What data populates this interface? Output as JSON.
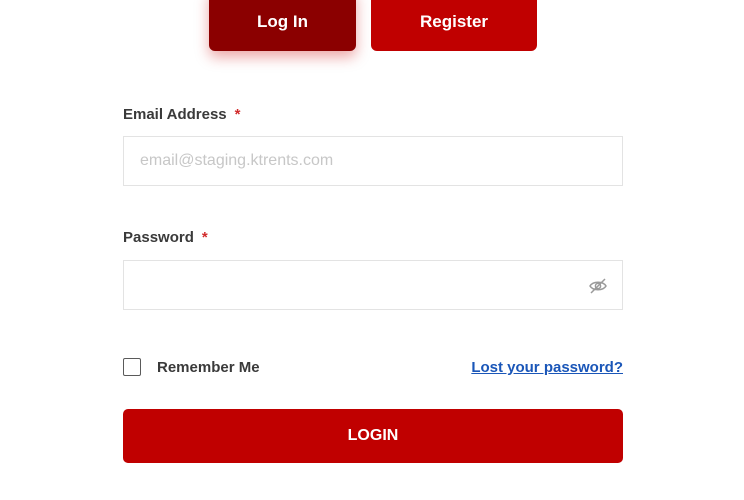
{
  "tabs": {
    "login_label": "Log In",
    "register_label": "Register"
  },
  "email": {
    "label": "Email Address",
    "required_mark": "*",
    "placeholder": "email@staging.ktrents.com",
    "value": ""
  },
  "password": {
    "label": "Password",
    "required_mark": "*",
    "value": "",
    "toggle_icon": "eye-slash-icon"
  },
  "remember": {
    "label": "Remember Me",
    "checked": false
  },
  "lost_password": {
    "label": "Lost your password?"
  },
  "submit": {
    "label": "LOGIN"
  },
  "colors": {
    "active_tab": "#8b0000",
    "accent": "#c00000",
    "link": "#1a56b8",
    "required": "#d12b2b"
  }
}
